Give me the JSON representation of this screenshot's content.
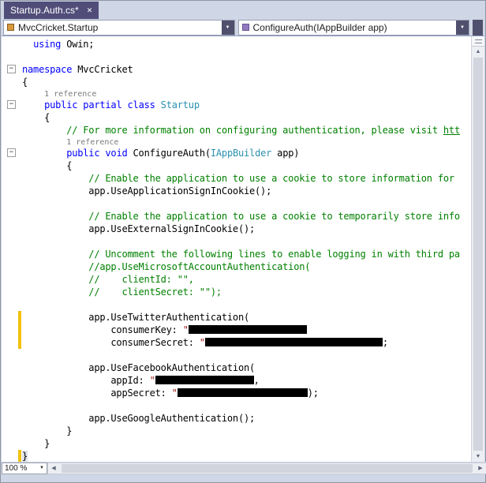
{
  "tab_bar": {
    "tabs": [
      {
        "title": "Startup.Auth.cs*",
        "active": true
      }
    ]
  },
  "navigation_bar": {
    "scope_dropdown": {
      "label": "MvcCricket.Startup",
      "icon": "class-icon"
    },
    "member_dropdown": {
      "label": "ConfigureAuth(IAppBuilder app)",
      "icon": "method-icon"
    }
  },
  "zoom_control": {
    "value": "100 %"
  },
  "icons": {
    "close": "✕",
    "dropdown": "▼",
    "scroll_up": "▲",
    "scroll_down": "▼",
    "scroll_left": "◀",
    "scroll_right": "▶",
    "fold_collapse": "−"
  },
  "colors": {
    "active_tab": "#514d79",
    "keyword": "#0000ff",
    "type_name": "#2b91af",
    "comment": "#008000",
    "string": "#a31515",
    "codelens_text": "#7a7a7a",
    "change_bar_yellow": "#f0c20c",
    "editor_bg": "#ffffff",
    "chrome_bg": "#cfd6e5"
  },
  "editor": {
    "fold_icon": "−",
    "codelens_label": "1 reference",
    "lines": [
      {
        "seg": [
          [
            "pl",
            "  "
          ],
          [
            "kw",
            "using"
          ],
          [
            "pl",
            " Owin;"
          ]
        ]
      },
      {
        "seg": []
      },
      {
        "fold": true,
        "seg": [
          [
            "kw",
            "namespace"
          ],
          [
            "pl",
            " MvcCricket"
          ]
        ]
      },
      {
        "seg": [
          [
            "pl",
            "{"
          ]
        ]
      },
      {
        "small": true,
        "seg": [
          [
            "pl",
            "    "
          ],
          [
            "lens",
            "1 reference"
          ]
        ]
      },
      {
        "fold": true,
        "seg": [
          [
            "pl",
            "    "
          ],
          [
            "kw",
            "public"
          ],
          [
            "pl",
            " "
          ],
          [
            "kw",
            "partial"
          ],
          [
            "pl",
            " "
          ],
          [
            "kw",
            "class"
          ],
          [
            "pl",
            " "
          ],
          [
            "type",
            "Startup"
          ]
        ]
      },
      {
        "seg": [
          [
            "pl",
            "    {"
          ]
        ]
      },
      {
        "seg": [
          [
            "pl",
            "        "
          ],
          [
            "cm",
            "// For more information on configuring authentication, please visit "
          ],
          [
            "cmu",
            "htt"
          ]
        ]
      },
      {
        "small": true,
        "seg": [
          [
            "pl",
            "        "
          ],
          [
            "lens",
            "1 reference"
          ]
        ]
      },
      {
        "fold": true,
        "seg": [
          [
            "pl",
            "        "
          ],
          [
            "kw",
            "public"
          ],
          [
            "pl",
            " "
          ],
          [
            "kw",
            "void"
          ],
          [
            "pl",
            " ConfigureAuth("
          ],
          [
            "type",
            "IAppBuilder"
          ],
          [
            "pl",
            " app)"
          ]
        ]
      },
      {
        "seg": [
          [
            "pl",
            "        {"
          ]
        ]
      },
      {
        "seg": [
          [
            "pl",
            "            "
          ],
          [
            "cm",
            "// Enable the application to use a cookie to store information for"
          ]
        ]
      },
      {
        "seg": [
          [
            "pl",
            "            app.UseApplicationSignInCookie();"
          ]
        ]
      },
      {
        "seg": []
      },
      {
        "seg": [
          [
            "pl",
            "            "
          ],
          [
            "cm",
            "// Enable the application to use a cookie to temporarily store info"
          ]
        ]
      },
      {
        "seg": [
          [
            "pl",
            "            app.UseExternalSignInCookie();"
          ]
        ]
      },
      {
        "seg": []
      },
      {
        "seg": [
          [
            "pl",
            "            "
          ],
          [
            "cm",
            "// Uncomment the following lines to enable logging in with third pa"
          ]
        ]
      },
      {
        "seg": [
          [
            "pl",
            "            "
          ],
          [
            "cm",
            "//app.UseMicrosoftAccountAuthentication("
          ]
        ]
      },
      {
        "seg": [
          [
            "pl",
            "            "
          ],
          [
            "cm",
            "//    clientId: \"\","
          ]
        ]
      },
      {
        "seg": [
          [
            "pl",
            "            "
          ],
          [
            "cm",
            "//    clientSecret: \"\");"
          ]
        ]
      },
      {
        "seg": []
      },
      {
        "chg": true,
        "seg": [
          [
            "pl",
            "            app.UseTwitterAuthentication("
          ]
        ]
      },
      {
        "chg": true,
        "seg": [
          [
            "pl",
            "                consumerKey: "
          ],
          [
            "str",
            "\""
          ],
          [
            "bar",
            150
          ]
        ]
      },
      {
        "chg": true,
        "seg": [
          [
            "pl",
            "                consumerSecret: "
          ],
          [
            "str",
            "\""
          ],
          [
            "bar",
            225
          ],
          [
            "pl",
            ";"
          ]
        ]
      },
      {
        "seg": []
      },
      {
        "seg": [
          [
            "pl",
            "            app.UseFacebookAuthentication("
          ]
        ]
      },
      {
        "seg": [
          [
            "pl",
            "                appId: "
          ],
          [
            "str",
            "\""
          ],
          [
            "bar",
            125
          ],
          [
            "pl",
            ","
          ]
        ]
      },
      {
        "seg": [
          [
            "pl",
            "                appSecret: "
          ],
          [
            "str",
            "\""
          ],
          [
            "bar",
            165
          ],
          [
            "pl",
            ");"
          ]
        ]
      },
      {
        "seg": []
      },
      {
        "seg": [
          [
            "pl",
            "            app.UseGoogleAuthentication();"
          ]
        ]
      },
      {
        "seg": [
          [
            "pl",
            "        }"
          ]
        ]
      },
      {
        "seg": [
          [
            "pl",
            "    }"
          ]
        ]
      },
      {
        "chg": true,
        "seg": [
          [
            "brh",
            "}"
          ]
        ]
      }
    ]
  }
}
